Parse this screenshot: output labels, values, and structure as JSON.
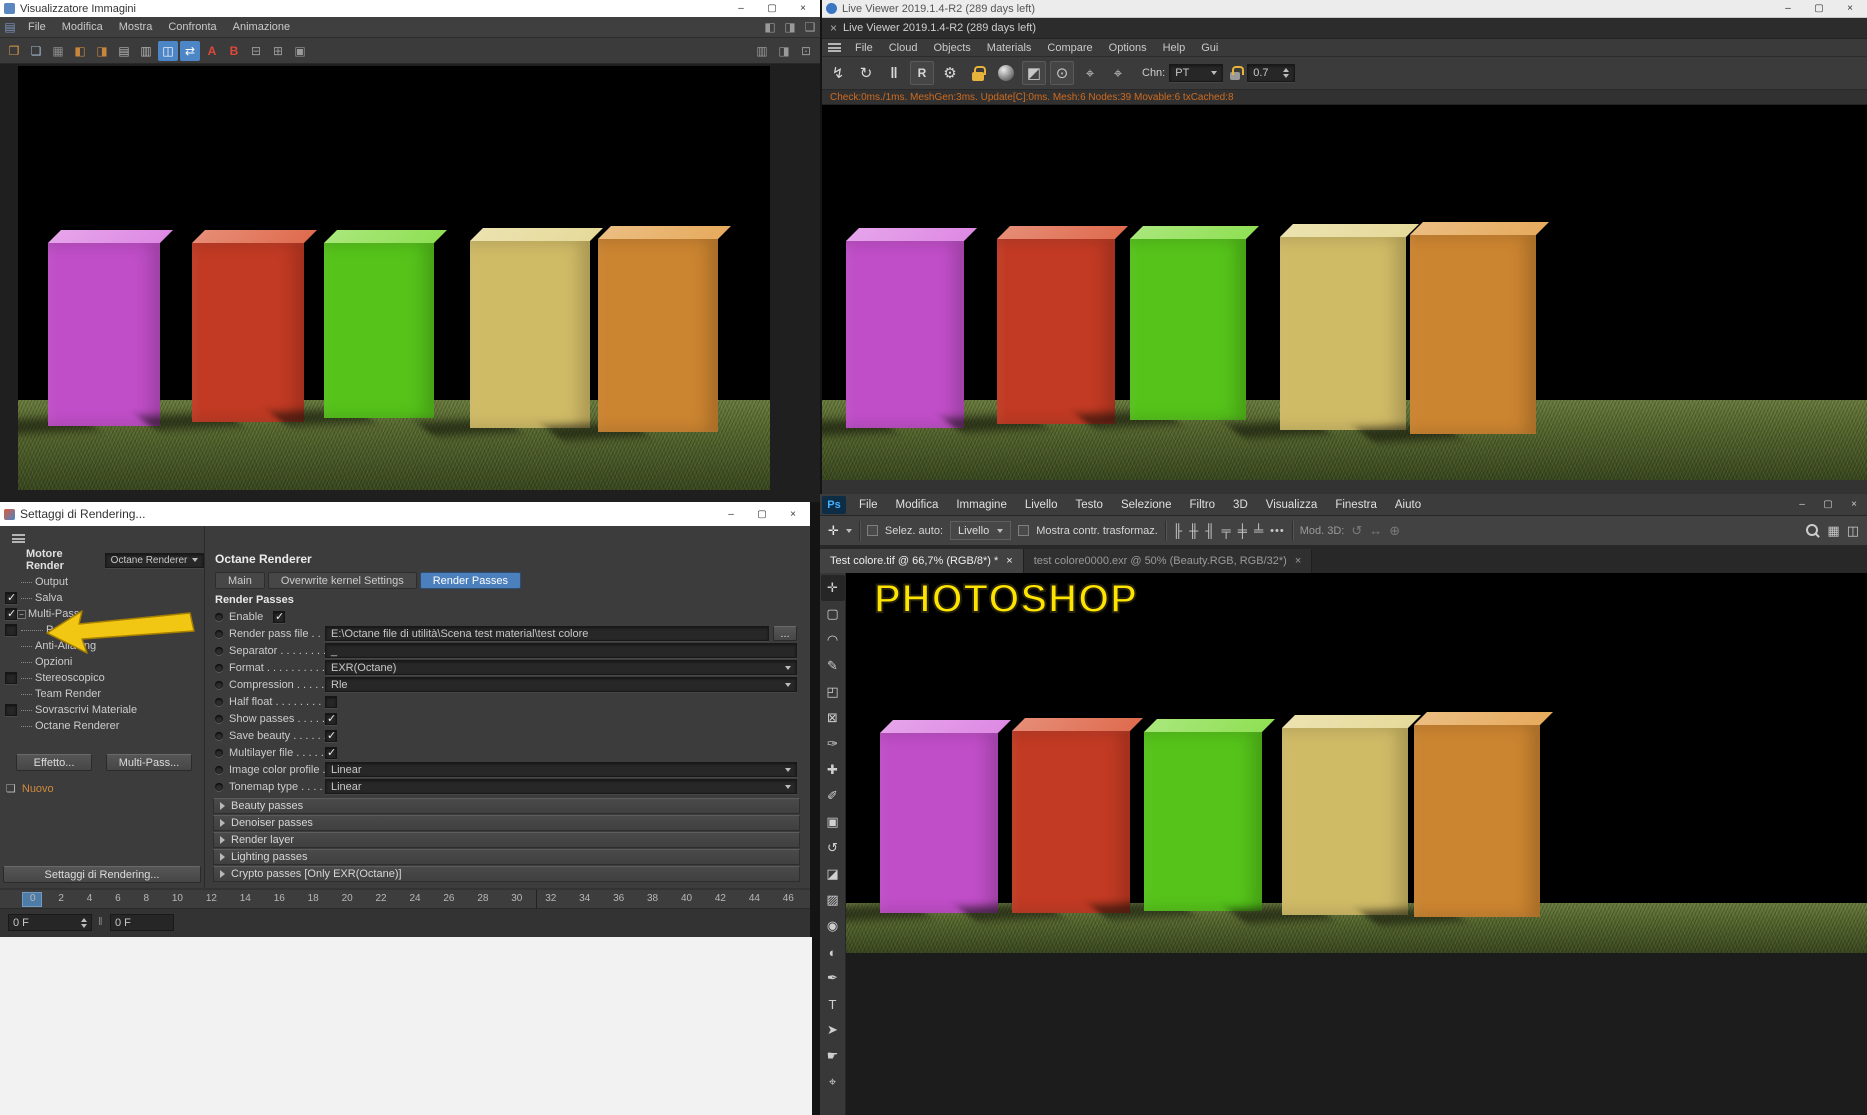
{
  "chrome": {
    "minimize": "–",
    "maximize": "▢",
    "close": "×"
  },
  "scene": {
    "grass_light": "#6a7c3e",
    "grass_dark": "#3a481f",
    "boxes": [
      {
        "name": "magenta-box",
        "front": "#c04ec8",
        "top": "#de8ae4"
      },
      {
        "name": "red-box",
        "front": "#c23a23",
        "top": "#df6c4f"
      },
      {
        "name": "green-box",
        "front": "#55c31a",
        "top": "#90e055"
      },
      {
        "name": "tan-box",
        "front": "#cfba66",
        "top": "#e6da9a"
      },
      {
        "name": "orange-box",
        "front": "#cb8430",
        "top": "#e6ab5e"
      }
    ]
  },
  "picture_viewer": {
    "title": "Visualizzatore Immagini",
    "menus": [
      "File",
      "Modifica",
      "Mostra",
      "Confronta",
      "Animazione"
    ],
    "menubar_icons": [
      {
        "name": "dock-left-icon",
        "glyph": "◧",
        "color": "#9a9a9a"
      },
      {
        "name": "dock-right-icon",
        "glyph": "◨",
        "color": "#9a9a9a"
      },
      {
        "name": "float-panel-icon",
        "glyph": "❏",
        "color": "#9a9a9a"
      }
    ],
    "toolbar_icons": [
      {
        "name": "open-file-icon",
        "glyph": "❐",
        "color": "#d79b43"
      },
      {
        "name": "save-image-icon",
        "glyph": "❏",
        "color": "#9fb6c9"
      },
      {
        "name": "ram-player-icon",
        "glyph": "▦",
        "color": "#8a8a8a"
      },
      {
        "name": "compare-a-icon",
        "glyph": "◧",
        "color": "#c8853c"
      },
      {
        "name": "compare-b-icon",
        "glyph": "◨",
        "color": "#c8853c"
      },
      {
        "name": "history-panel-icon",
        "glyph": "▤",
        "color": "#b5b5b5"
      },
      {
        "name": "content-browser-icon",
        "glyph": "▥",
        "color": "#b5b5b5"
      },
      {
        "name": "dual-view-icon",
        "glyph": "◫",
        "color": "#ffffff",
        "bg": "#4d86c6"
      },
      {
        "name": "link-views-icon",
        "glyph": "⇄",
        "color": "#ffffff",
        "bg": "#4d86c6"
      },
      {
        "name": "set-image-a-icon",
        "glyph": "A",
        "color": "#e0483a"
      },
      {
        "name": "set-image-b-icon",
        "glyph": "B",
        "color": "#e0483a"
      },
      {
        "name": "split-horizontal-icon",
        "glyph": "⊟",
        "color": "#9a9a9a"
      },
      {
        "name": "split-vertical-icon",
        "glyph": "⊞",
        "color": "#9a9a9a"
      },
      {
        "name": "grid-view-icon",
        "glyph": "▣",
        "color": "#9a9a9a"
      }
    ],
    "toolbar_right_icons": [
      {
        "name": "histogram-panel-icon",
        "glyph": "▥",
        "color": "#9a9a9a"
      },
      {
        "name": "info-panel-icon",
        "glyph": "◨",
        "color": "#9a9a9a"
      },
      {
        "name": "navigator-panel-icon",
        "glyph": "⊡",
        "color": "#9a9a9a"
      }
    ]
  },
  "live_viewer": {
    "title": "Live Viewer 2019.1.4-R2 (289 days left)",
    "tab_title": "Live Viewer 2019.1.4-R2 (289 days left)",
    "tab_close": "×",
    "menus": [
      "File",
      "Cloud",
      "Objects",
      "Materials",
      "Compare",
      "Options",
      "Help",
      "Gui"
    ],
    "toolbar_icons": [
      {
        "name": "trigger-render-icon",
        "glyph": "↯",
        "color": "#d8d8d8"
      },
      {
        "name": "restart-render-icon",
        "glyph": "↻",
        "color": "#d8d8d8"
      },
      {
        "name": "pause-render-icon",
        "glyph": "‖",
        "color": "#d8d8d8"
      },
      {
        "name": "region-render-icon",
        "glyph": "R",
        "color": "#d8d8d8"
      },
      {
        "name": "kernel-settings-gear-icon",
        "glyph": "⚙",
        "color": "#d8d8d8"
      },
      {
        "name": "resolution-lock-icon"
      },
      {
        "name": "material-ball-icon"
      },
      {
        "name": "pick-material-icon",
        "glyph": "◩",
        "color": "#c8c8c8"
      },
      {
        "name": "pick-object-icon",
        "glyph": "⊙",
        "color": "#c8c8c8"
      },
      {
        "name": "pick-focus-icon",
        "glyph": "⌖",
        "color": "#c8c8c8"
      },
      {
        "name": "pick-white-balance-icon",
        "glyph": "⌖",
        "color": "#c8c8c8"
      }
    ],
    "chn_label": "Chn:",
    "chn_value": "PT",
    "samples_value": "0.7",
    "status": "Check:0ms./1ms. MeshGen:3ms. Update[C]:0ms. Mesh:6 Nodes:39 Movable:6 txCached:8"
  },
  "render_settings": {
    "title": "Settaggi di Rendering...",
    "engine_label": "Motore Render",
    "engine_value": "Octane Renderer",
    "tree": [
      {
        "label": "Output"
      },
      {
        "label": "Salva"
      },
      {
        "label": "Multi-Pass"
      },
      {
        "label": "Post Effetti"
      },
      {
        "label": "Anti-Aliasing"
      },
      {
        "label": "Opzioni"
      },
      {
        "label": "Stereoscopico"
      },
      {
        "label": "Team Render"
      },
      {
        "label": "Sovrascrivi Materiale"
      },
      {
        "label": "Octane Renderer"
      }
    ],
    "effect_button": "Effetto...",
    "multipass_button": "Multi-Pass...",
    "new_label": "Nuovo",
    "bottom_button": "Settaggi di Rendering...",
    "panel": {
      "title": "Octane Renderer",
      "tabs": [
        "Main",
        "Overwrite kernel Settings",
        "Render Passes"
      ],
      "section_title": "Render Passes",
      "enable_label": "Enable",
      "render_pass_file_label": "Render pass file . .",
      "render_pass_file_value": "E:\\Octane file di utilità\\Scena test material\\test colore",
      "browse_button": "...",
      "separator_label": "Separator . . . . . . . .",
      "separator_value": "_",
      "format_label": "Format . . . . . . . . . .",
      "format_value": "EXR(Octane)",
      "compression_label": "Compression . . . . .",
      "compression_value": "Rle",
      "half_float_label": "Half float . . . . . . . . .",
      "show_passes_label": "Show passes . . . . .",
      "save_beauty_label": "Save beauty . . . . . .",
      "multilayer_label": "Multilayer file . . . . .",
      "icp_label": "Image color profile . .",
      "icp_value": "Linear",
      "tonemap_label": "Tonemap type . . . .",
      "tonemap_value": "Linear",
      "groups": [
        "Beauty passes",
        "Denoiser passes",
        "Render layer",
        "Lighting passes",
        "Crypto passes [Only EXR(Octane)]"
      ]
    }
  },
  "timeline": {
    "ticks": [
      "0",
      "2",
      "4",
      "6",
      "8",
      "10",
      "12",
      "14",
      "16",
      "18",
      "20",
      "22",
      "24",
      "26",
      "28",
      "30",
      "32",
      "34",
      "36",
      "38",
      "40",
      "42",
      "44",
      "46"
    ],
    "frame_value": "0 F",
    "frame_value2": "0 F"
  },
  "photoshop": {
    "logo": "Ps",
    "menus": [
      "File",
      "Modifica",
      "Immagine",
      "Livello",
      "Testo",
      "Selezione",
      "Filtro",
      "3D",
      "Visualizza",
      "Finestra",
      "Aiuto"
    ],
    "options": {
      "autoselect_label": "Selez. auto:",
      "autoselect_value": "Livello",
      "transform_label": "Mostra contr. trasformaz.",
      "more_label": "•••",
      "mode3d_label": "Mod. 3D:"
    },
    "align_icons": [
      {
        "name": "align-left-icon",
        "glyph": "╟"
      },
      {
        "name": "align-center-h-icon",
        "glyph": "╫"
      },
      {
        "name": "align-right-icon",
        "glyph": "╢"
      },
      {
        "name": "align-top-icon",
        "glyph": "╤"
      },
      {
        "name": "align-middle-icon",
        "glyph": "╪"
      },
      {
        "name": "align-bottom-icon",
        "glyph": "╧"
      }
    ],
    "mode3d_icons": [
      {
        "name": "orbit-3d-icon",
        "glyph": "↺"
      },
      {
        "name": "pan-3d-icon",
        "glyph": "↔"
      },
      {
        "name": "dolly-3d-icon",
        "glyph": "⊕"
      }
    ],
    "right_icons": [
      {
        "name": "arrange-documents-icon",
        "glyph": "▦"
      },
      {
        "name": "workspace-switcher-icon",
        "glyph": "◫"
      }
    ],
    "tabs": [
      {
        "label": "Test colore.tif @ 66,7% (RGB/8*) *",
        "close": "×"
      },
      {
        "label": "test colore0000.exr @ 50% (Beauty.RGB, RGB/32*)",
        "close": "×"
      }
    ],
    "tools": [
      {
        "name": "move-tool",
        "glyph": "✛"
      },
      {
        "name": "marquee-tool",
        "glyph": "▢"
      },
      {
        "name": "lasso-tool",
        "glyph": "◠"
      },
      {
        "name": "quick-selection-tool",
        "glyph": "✎"
      },
      {
        "name": "crop-tool",
        "glyph": "◰"
      },
      {
        "name": "frame-tool",
        "glyph": "⊠"
      },
      {
        "name": "eyedropper-tool",
        "glyph": "✑"
      },
      {
        "name": "healing-brush-tool",
        "glyph": "✚"
      },
      {
        "name": "brush-tool",
        "glyph": "✐"
      },
      {
        "name": "clone-stamp-tool",
        "glyph": "▣"
      },
      {
        "name": "history-brush-tool",
        "glyph": "↺"
      },
      {
        "name": "eraser-tool",
        "glyph": "◪"
      },
      {
        "name": "gradient-tool",
        "glyph": "▨"
      },
      {
        "name": "blur-tool",
        "glyph": "◉"
      },
      {
        "name": "dodge-tool",
        "glyph": "◐"
      },
      {
        "name": "pen-tool",
        "glyph": "✒"
      },
      {
        "name": "type-tool",
        "glyph": "T"
      },
      {
        "name": "path-selection-tool",
        "glyph": "➤"
      },
      {
        "name": "hand-tool",
        "glyph": "☛"
      },
      {
        "name": "zoom-tool",
        "glyph": "⌖"
      }
    ],
    "overlay_text": "PHOTOSHOP"
  }
}
